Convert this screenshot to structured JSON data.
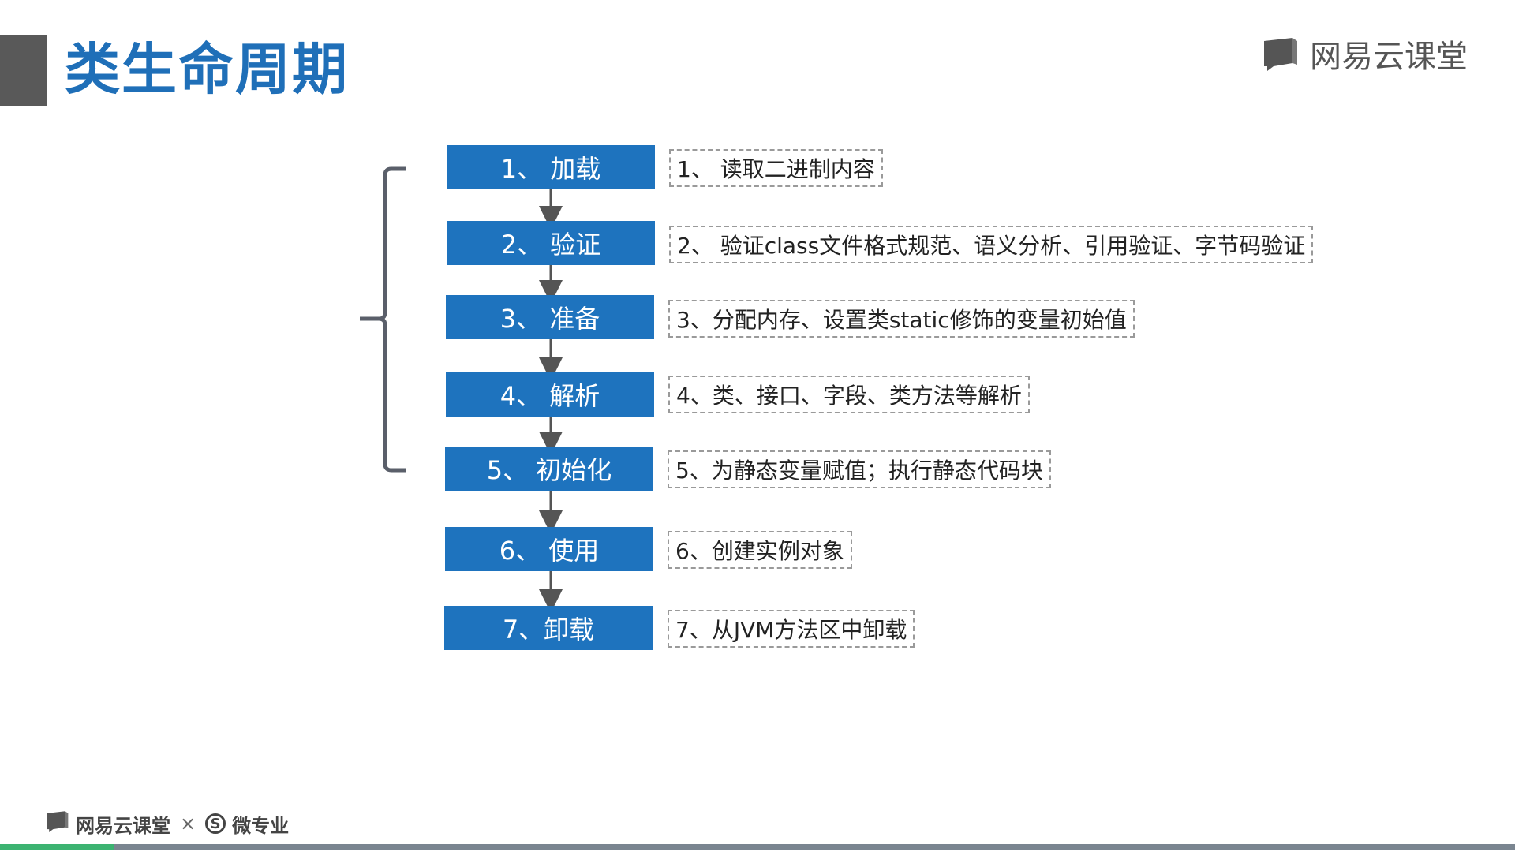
{
  "slide": {
    "title": "类生命周期",
    "brand": "网易云课堂"
  },
  "steps": [
    {
      "label": "1、 加载",
      "desc": "1、 读取二进制内容"
    },
    {
      "label": "2、 验证",
      "desc": "2、 验证class文件格式规范、语义分析、引用验证、字节码验证"
    },
    {
      "label": "3、 准备",
      "desc": "3、分配内存、设置类static修饰的变量初始值"
    },
    {
      "label": "4、 解析",
      "desc": "4、类、接口、字段、类方法等解析"
    },
    {
      "label": "5、 初始化",
      "desc": "5、为静态变量赋值；执行静态代码块"
    },
    {
      "label": "6、 使用",
      "desc": "6、创建实例对象"
    },
    {
      "label": "7、卸载",
      "desc": "7、从JVM方法区中卸载"
    }
  ],
  "footer": {
    "brand": "网易云课堂",
    "separator": "×",
    "partner_badge": "S",
    "partner": "微专业"
  },
  "progress": {
    "fraction": 0.075
  },
  "colors": {
    "title": "#1f6fb8",
    "step_fill": "#1e73be",
    "progress": "#3cb371"
  },
  "icons": {
    "brand": "book-icon",
    "partner": "s-circle-icon"
  }
}
